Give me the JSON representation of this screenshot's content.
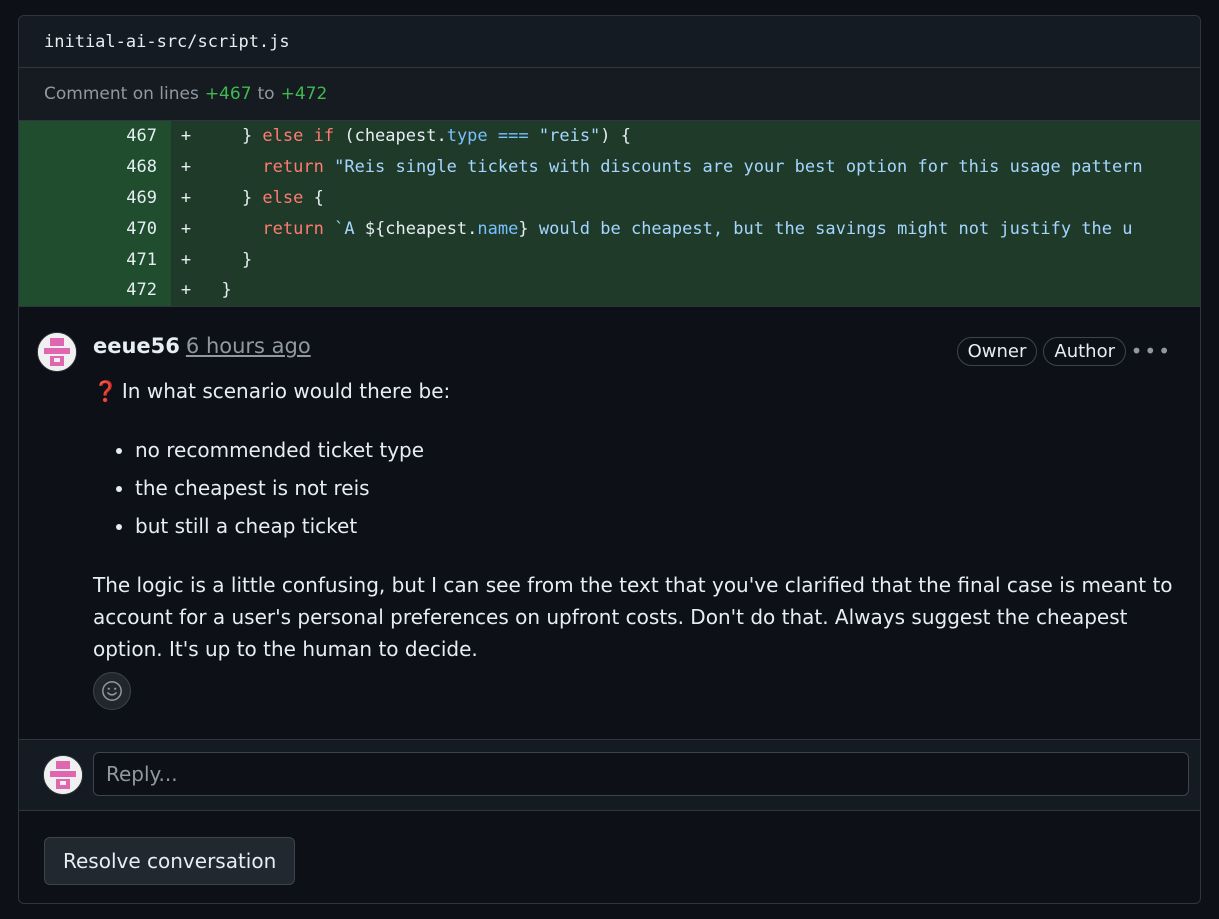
{
  "file": {
    "path": "initial-ai-src/script.js"
  },
  "comment_range": {
    "prefix": "Comment on lines",
    "start": "+467",
    "sep": "to",
    "end": "+472"
  },
  "code_lines": [
    {
      "num": "467",
      "marker": "+"
    },
    {
      "num": "468",
      "marker": "+"
    },
    {
      "num": "469",
      "marker": "+"
    },
    {
      "num": "470",
      "marker": "+"
    },
    {
      "num": "471",
      "marker": "+"
    },
    {
      "num": "472",
      "marker": "+"
    }
  ],
  "code_tokens": {
    "l467": [
      "    } ",
      "else",
      " ",
      "if",
      " (cheapest.",
      "type",
      " ",
      "===",
      " ",
      "\"reis\"",
      ") {"
    ],
    "l468": [
      "      ",
      "return",
      " ",
      "\"Reis single tickets with discounts are your best option for this usage pattern"
    ],
    "l469": [
      "    } ",
      "else",
      " {"
    ],
    "l470": [
      "      ",
      "return",
      " ",
      "`A ",
      "${cheapest.",
      "name",
      "}",
      " would be cheapest, but the savings might not justify the u"
    ],
    "l471": [
      "    }"
    ],
    "l472": [
      "  }"
    ]
  },
  "comment": {
    "author": "eeue56",
    "time": "6 hours ago",
    "badges": [
      "Owner",
      "Author"
    ],
    "intro": "In what scenario would there be:",
    "question_icon": "❓",
    "bullets": [
      "no recommended ticket type",
      "the cheapest is not reis",
      "but still a cheap ticket"
    ],
    "paragraph": "The logic is a little confusing, but I can see from the text that you've clarified that the final case is meant to account for a user's personal preferences on upfront costs. Don't do that. Always suggest the cheapest option. It's up to the human to decide."
  },
  "reply": {
    "placeholder": "Reply..."
  },
  "resolve": {
    "label": "Resolve conversation"
  },
  "colors": {
    "background": "#0d1117",
    "added_line": "#1f3a29",
    "keyword": "#ff7b72",
    "string": "#a5d6ff",
    "line_range": "#3fb950"
  }
}
